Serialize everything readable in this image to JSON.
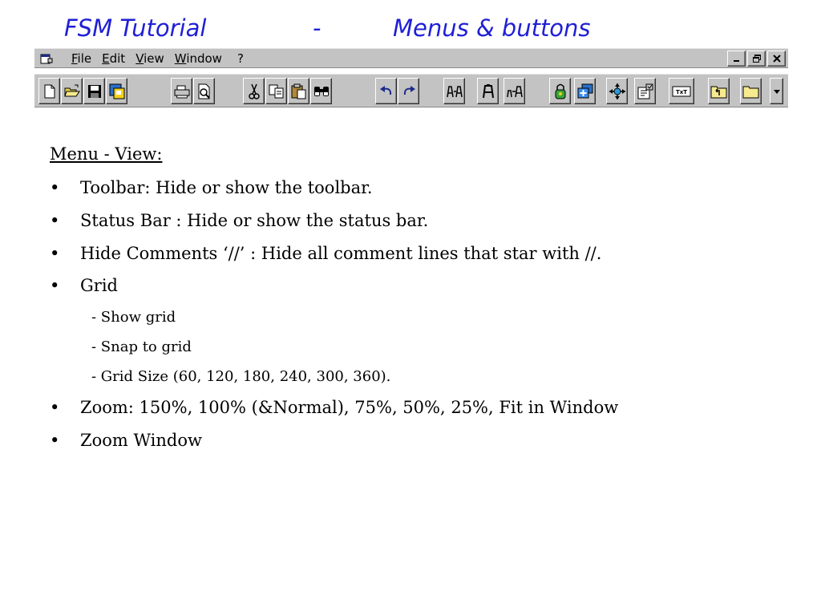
{
  "title": {
    "left": "FSM  Tutorial",
    "dash": "-",
    "right": "Menus & buttons",
    "color": "#1f1fd6"
  },
  "menubar": {
    "icon": "document-window-icon",
    "items": [
      "File",
      "Edit",
      "View",
      "Window",
      "?"
    ],
    "controls": [
      "minimize-icon",
      "restore-icon",
      "close-icon"
    ]
  },
  "toolbar": {
    "buttons": [
      "new-file-icon",
      "open-folder-icon",
      "save-icon",
      "save-color-icon",
      "print-icon",
      "print-preview-icon",
      "cut-icon",
      "copy-icon",
      "paste-icon",
      "find-icon",
      "undo-icon",
      "redo-icon",
      "state-to-state-icon",
      "state-icon",
      "state-arrow-icon",
      "lock-icon",
      "add-state-icon",
      "transition-icon",
      "properties-icon",
      "text-icon",
      "folder-up-icon",
      "folder-icon",
      "dropdown-icon"
    ]
  },
  "content": {
    "heading": "Menu - View:",
    "bullets": [
      "Toolbar: Hide or show the toolbar.",
      "Status Bar : Hide or show the status bar.",
      "Hide Comments ‘//’ : Hide all comment lines that star with //.",
      "Grid",
      "Zoom: 150%, 100% (&Normal), 75%, 50%, 25%, Fit in Window",
      "Zoom Window"
    ],
    "grid_sub": [
      "- Show grid",
      "- Snap to grid",
      "- Grid Size (60, 120, 180, 240, 300, 360)."
    ],
    "bullet_char": "•"
  }
}
